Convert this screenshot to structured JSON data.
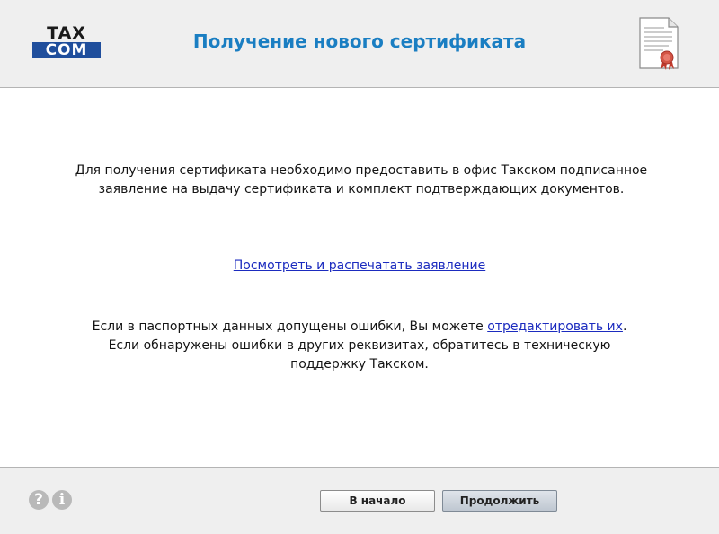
{
  "header": {
    "logo_top": "TAX",
    "logo_bottom": "COM",
    "title": "Получение нового сертификата"
  },
  "content": {
    "paragraph1_line1": "Для получения сертификата необходимо предоставить в офис Такском подписанное",
    "paragraph1_line2": "заявление на выдачу сертификата и комплект подтверждающих документов.",
    "view_print_link": "Посмотреть и распечатать заявление",
    "paragraph2_line1_prefix": "Если в паспортных данных допущены ошибки, Вы можете ",
    "edit_link": "отредактировать их",
    "paragraph2_line1_suffix": ".",
    "paragraph2_line2": "Если обнаружены ошибки в других реквизитах, обратитесь в техническую",
    "paragraph2_line3": "поддержку Такском."
  },
  "footer": {
    "help_glyph": "?",
    "info_glyph": "i",
    "start_button": "В начало",
    "next_button": "Продолжить"
  },
  "icons": {
    "logo": "taxcom-logo",
    "header_icon": "certificate-document-icon",
    "help": "help-icon",
    "info": "info-icon"
  }
}
